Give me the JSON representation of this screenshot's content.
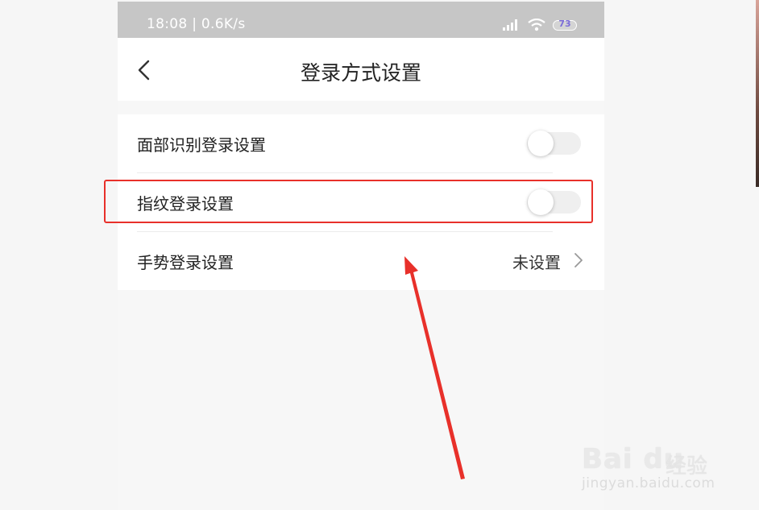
{
  "status_bar": {
    "time": "18:08 | 0.6K/s",
    "battery": "73",
    "icons": [
      "signal-icon",
      "wifi-icon",
      "battery-icon"
    ]
  },
  "nav": {
    "title": "登录方式设置",
    "back_icon": "chevron-left-icon"
  },
  "settings": {
    "face_login": {
      "label": "面部识别登录设置",
      "enabled": false
    },
    "fingerprint_login": {
      "label": "指纹登录设置",
      "enabled": false
    },
    "gesture_login": {
      "label": "手势登录设置",
      "value": "未设置"
    }
  },
  "watermark": {
    "logo": "Bai du",
    "text": "经验",
    "url": "jingyan.baidu.com"
  },
  "colors": {
    "annotation": "#e8302a",
    "status_bar_bg": "#c6c6c6",
    "battery_text": "#7b6cd9"
  }
}
